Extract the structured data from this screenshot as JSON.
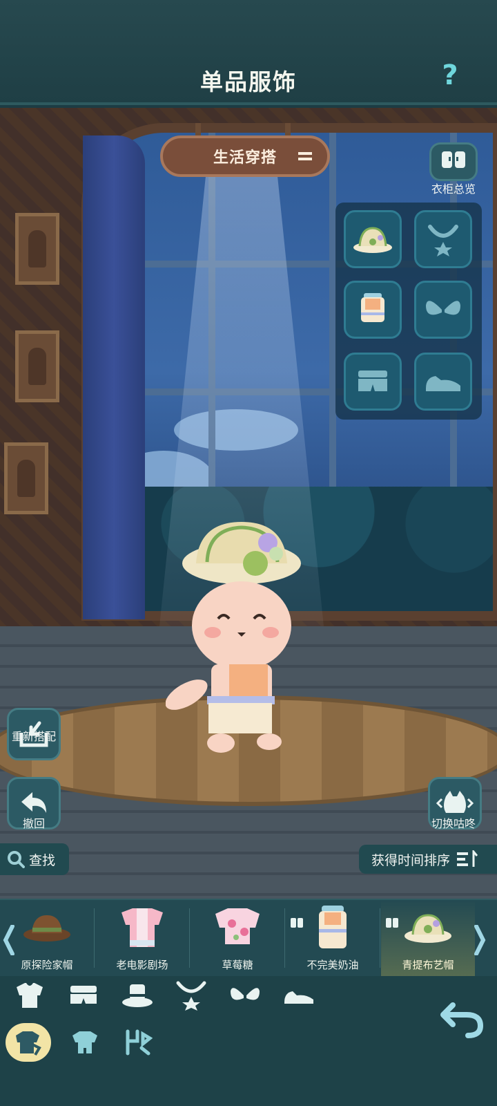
{
  "header": {
    "title": "单品服饰",
    "help_label": "?"
  },
  "scene": {
    "outfit_selector": {
      "label": "生活穿搭",
      "icon": "dropdown-lines-icon"
    },
    "wardrobe_overview": {
      "label": "衣柜总览",
      "icon": "wardrobe-icon"
    },
    "restyle": {
      "label": "重新搭配",
      "icon": "restyle-icon"
    },
    "undo": {
      "label": "撤回",
      "icon": "undo-arrow-icon"
    },
    "switch_character": {
      "label": "切换咕咚",
      "icon": "cat-face-icon"
    },
    "slots": [
      {
        "name": "hat",
        "icon": "hat-slot-icon",
        "filled": true
      },
      {
        "name": "necklace",
        "icon": "necklace-slot-icon",
        "filled": false
      },
      {
        "name": "top",
        "icon": "top-slot-icon",
        "filled": true
      },
      {
        "name": "wings",
        "icon": "wings-slot-icon",
        "filled": false
      },
      {
        "name": "pants",
        "icon": "pants-slot-icon",
        "filled": false
      },
      {
        "name": "shoes",
        "icon": "shoes-slot-icon",
        "filled": false
      }
    ]
  },
  "toolbar": {
    "search_label": "查找",
    "sort_label": "获得时间排序"
  },
  "items": [
    {
      "name": "原探险家帽",
      "icon": "explorer-hat-icon",
      "owned_badge": false,
      "selected": false
    },
    {
      "name": "老电影剧场",
      "icon": "pink-shirt-icon",
      "owned_badge": false,
      "selected": false
    },
    {
      "name": "草莓糖",
      "icon": "strawberry-top-icon",
      "owned_badge": false,
      "selected": false
    },
    {
      "name": "不完美奶油",
      "icon": "cream-apron-icon",
      "owned_badge": true,
      "selected": false
    },
    {
      "name": "青提布艺帽",
      "icon": "green-grape-hat-icon",
      "owned_badge": true,
      "selected": true
    }
  ],
  "categories": [
    "top-category-icon",
    "pants-category-icon",
    "hat-category-icon",
    "necklace-category-icon",
    "wings-category-icon",
    "shoes-category-icon"
  ],
  "modes": [
    {
      "icon": "single-item-mode-icon",
      "active": true
    },
    {
      "icon": "suit-mode-icon",
      "active": false
    },
    {
      "icon": "action-mode-icon",
      "active": false
    }
  ],
  "colors": {
    "accent": "#6fd6dc",
    "panel": "#1e5a70",
    "selected_tab": "#f2e4a6",
    "sign": "#7a4e3a"
  }
}
